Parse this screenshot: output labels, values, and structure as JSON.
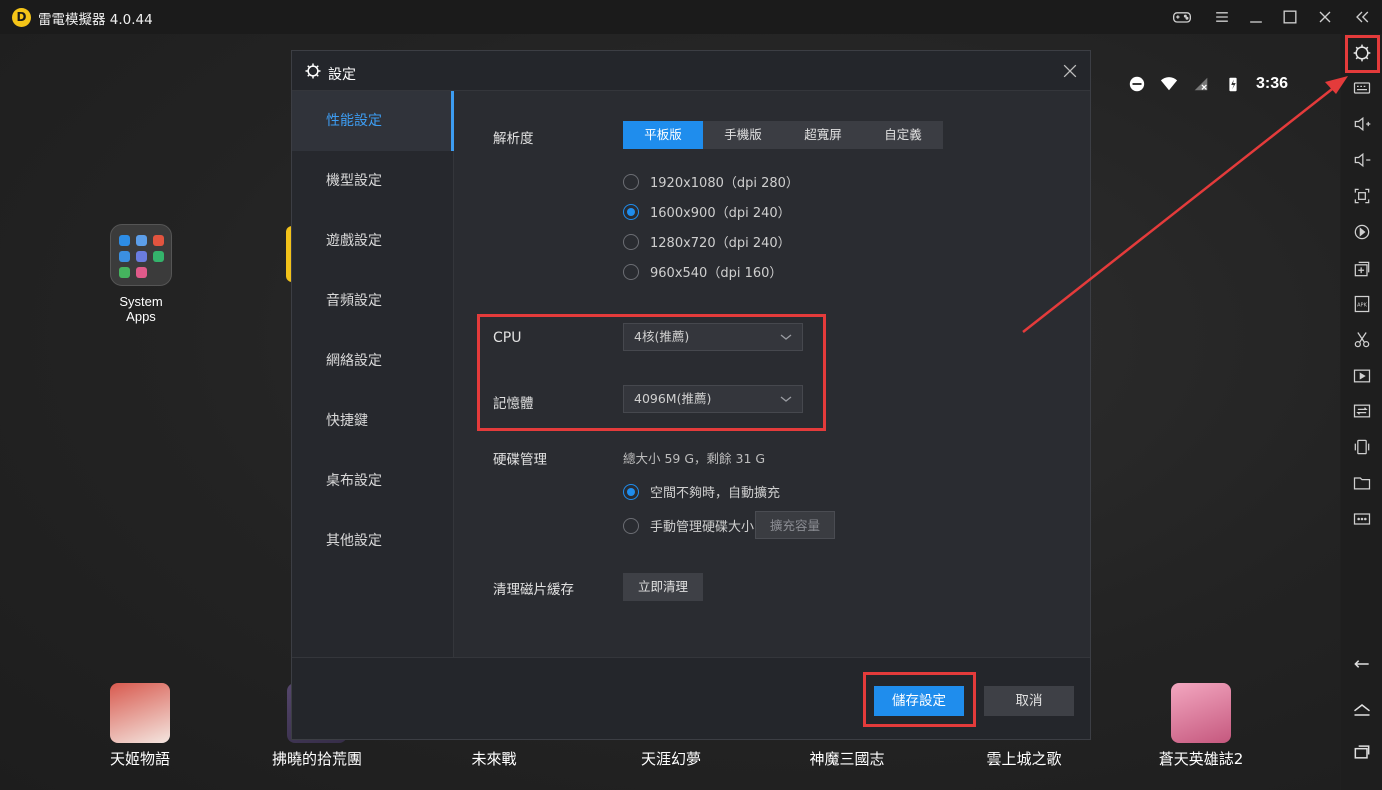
{
  "window": {
    "title": "雷電模擬器 4.0.44",
    "logo_letter": "D"
  },
  "status_bar": {
    "time": "3:36"
  },
  "desktop": {
    "folder_label": "System Apps",
    "dock_apps": [
      {
        "label": "天姬物語",
        "color": "#c9463d"
      },
      {
        "label": "拂曉的拾荒團",
        "color": "#7a5ea8"
      },
      {
        "label": "未來戰",
        "color": "#3a6fb0"
      },
      {
        "label": "天涯幻夢",
        "color": "#5a8fc8"
      },
      {
        "label": "神魔三國志",
        "color": "#9b3a2e"
      },
      {
        "label": "雲上城之歌",
        "color": "#4aa3c9"
      },
      {
        "label": "蒼天英雄誌2",
        "color": "#e58aa8"
      }
    ]
  },
  "dialog": {
    "title": "設定",
    "nav": [
      "性能設定",
      "機型設定",
      "遊戲設定",
      "音頻設定",
      "網絡設定",
      "快捷鍵",
      "桌布設定",
      "其他設定"
    ],
    "active_nav_index": 0,
    "resolution": {
      "label": "解析度",
      "tabs": [
        "平板版",
        "手機版",
        "超寬屏",
        "自定義"
      ],
      "active_tab": "平板版",
      "options": [
        "1920x1080（dpi 280）",
        "1600x900（dpi 240）",
        "1280x720（dpi 240）",
        "960x540（dpi 160）"
      ],
      "selected_option": "1600x900（dpi 240）"
    },
    "cpu": {
      "label": "CPU",
      "value": "4核(推薦)"
    },
    "memory": {
      "label": "記憶體",
      "value": "4096M(推薦)"
    },
    "disk": {
      "label": "硬碟管理",
      "summary": "總大小 59 G，剩餘 31 G",
      "option_auto": "空間不夠時，自動擴充",
      "option_manual": "手動管理硬碟大小",
      "expand_button": "擴充容量",
      "selected": "auto"
    },
    "cache": {
      "label": "清理磁片緩存",
      "button": "立即清理"
    },
    "footer": {
      "save": "儲存設定",
      "cancel": "取消"
    }
  },
  "colors": {
    "accent": "#1f8ded",
    "annotation_red": "#e43b3b",
    "dialog_bg": "#2a2c31"
  }
}
